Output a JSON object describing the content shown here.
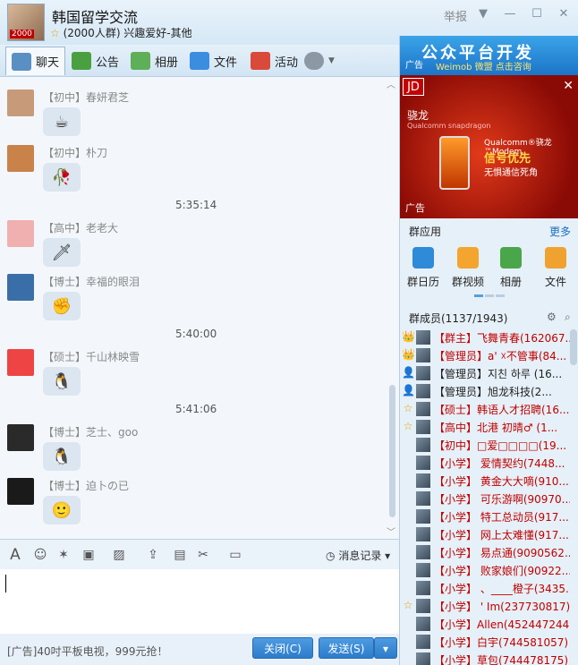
{
  "header": {
    "title": "韩国留学交流",
    "subtitle": "(2000人群) 兴趣爱好-其他",
    "avatar_label": "2000",
    "report": "举报"
  },
  "tabs": [
    "聊天",
    "公告",
    "相册",
    "文件",
    "活动"
  ],
  "messages": [
    {
      "name": "【初中】春妍君芝",
      "emoji": "☕"
    },
    {
      "name": "【初中】朴刀",
      "emoji": "🥀"
    },
    {
      "time": "5:35:14"
    },
    {
      "name": "【高中】老老大",
      "emoji": "🗡"
    },
    {
      "name": "【博士】幸福的眼泪",
      "emoji": "✊"
    },
    {
      "time": "5:40:00"
    },
    {
      "name": "【硕士】千山林映雪",
      "emoji": "🐧"
    },
    {
      "time": "5:41:06"
    },
    {
      "name": "【博士】芝士、goo",
      "emoji": "🐧"
    },
    {
      "name": "【博士】迫卜の已",
      "emoji": "🙂"
    }
  ],
  "toolbar": {
    "font_icon": "A",
    "message_record": "消息记录"
  },
  "bottom": {
    "ad_text": "[广告]40吋平板电视，999元抢！",
    "close_label": "关闭(C)",
    "send_label": "发送(S)"
  },
  "right": {
    "banner_title": "公众平台开发",
    "banner_sub": "Weimob 微盟 点击咨询",
    "banner_ad": "广告",
    "ad": {
      "brand": "JD",
      "snap": "骁龙",
      "snap_en": "Qualcomm snapdragon",
      "line1": "Qualcomm®骁龙™Modem",
      "line2": "信号优先",
      "line3": "无惧通信死角",
      "ad_label": "广告"
    },
    "apps_title": "群应用",
    "apps_more": "更多",
    "apps": [
      "群日历",
      "群视频",
      "相册",
      "文件"
    ],
    "members_title": "群成员(1137/1943)",
    "members": [
      {
        "text": "【群主】飞舞青春(162067...",
        "color": "#c00000",
        "badge": "👑"
      },
      {
        "text": "【管理员】a' ☓不管事(84...",
        "color": "#c00000",
        "badge": "👑"
      },
      {
        "text": "【管理员】지친 하루 (16...",
        "color": "#222222",
        "badge": "👤"
      },
      {
        "text": "【管理员】旭龙科技(2...",
        "color": "#222222",
        "badge": "👤"
      },
      {
        "text": "【硕士】韩语人才招聘(16...",
        "color": "#c00000",
        "badge": "☆"
      },
      {
        "text": "【高中】北港  初晴♂  (1...",
        "color": "#c00000",
        "badge": "☆"
      },
      {
        "text": "【初中】□爱□□□□(19...",
        "color": "#c00000",
        "badge": ""
      },
      {
        "text": "【小学】  爱情契约(7448...",
        "color": "#c00000",
        "badge": ""
      },
      {
        "text": "【小学】  黄金大大嘀(910...",
        "color": "#c00000",
        "badge": ""
      },
      {
        "text": "【小学】  可乐游啊(90970...",
        "color": "#c00000",
        "badge": ""
      },
      {
        "text": "【小学】  特工总动员(917...",
        "color": "#c00000",
        "badge": ""
      },
      {
        "text": "【小学】  网上太难懂(917...",
        "color": "#c00000",
        "badge": ""
      },
      {
        "text": "【小学】  易点通(9090562...",
        "color": "#c00000",
        "badge": ""
      },
      {
        "text": "【小学】  败家娘们(90922...",
        "color": "#c00000",
        "badge": ""
      },
      {
        "text": "【小学】  、____橙子(3435...",
        "color": "#c00000",
        "badge": ""
      },
      {
        "text": "【小学】 '      Im(237730817)",
        "color": "#c00000",
        "badge": "☆"
      },
      {
        "text": "【小学】Allen(452447244)",
        "color": "#c00000",
        "badge": ""
      },
      {
        "text": "【小学】白宇(744581057)",
        "color": "#c00000",
        "badge": ""
      },
      {
        "text": "【小学】草包(744478175)",
        "color": "#c00000",
        "badge": ""
      }
    ]
  }
}
